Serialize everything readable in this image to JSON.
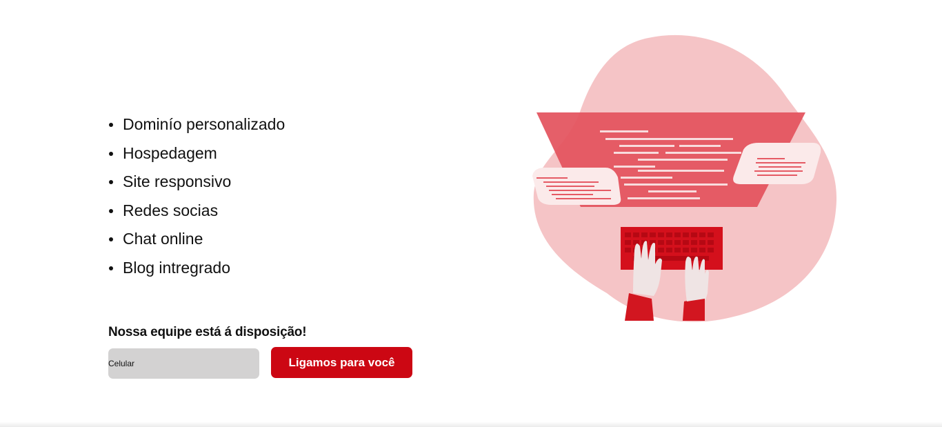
{
  "features": [
    {
      "label": "Dominío personalizado"
    },
    {
      "label": "Hospedagem"
    },
    {
      "label": "Site responsivo"
    },
    {
      "label": "Redes socias"
    },
    {
      "label": "Chat online"
    },
    {
      "label": "Blog intregrado"
    }
  ],
  "cta": {
    "heading": "Nossa equipe está á disposição!",
    "phone_placeholder": "Celular",
    "phone_value": "",
    "button_label": "Ligamos para você"
  },
  "illustration": {
    "icon": "developer-typing-illustration",
    "colors": {
      "blob": "#f5c4c6",
      "screen": "#e55a64",
      "keyboard": "#d4101c",
      "card": "#fbeaea",
      "sleeve": "#d21620"
    }
  },
  "colors": {
    "accent": "#cc0713",
    "input_bg": "#d3d2d2",
    "text": "#111111"
  }
}
